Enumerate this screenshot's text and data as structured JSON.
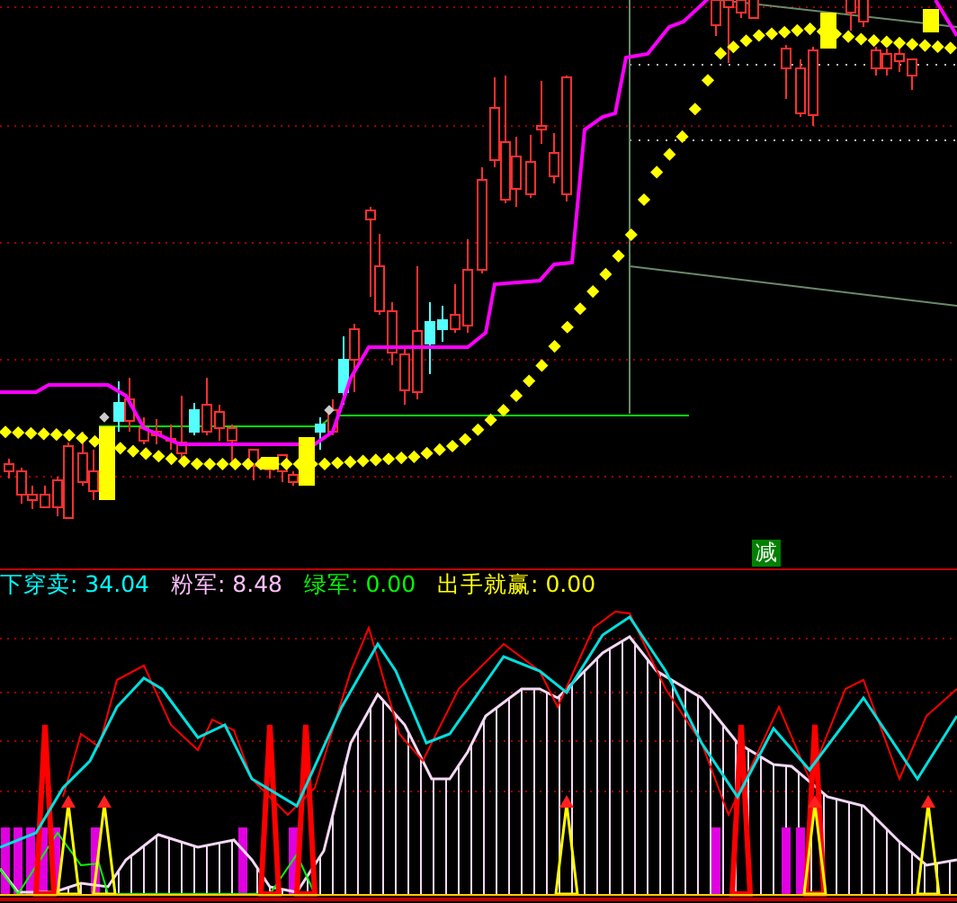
{
  "price_chart": {
    "signal_badge": "减"
  },
  "legend": [
    {
      "text": "下穿卖: 34.04",
      "color": "#00ffff"
    },
    {
      "text": "粉军: 8.48",
      "color": "#ffc0ff"
    },
    {
      "text": "绿军: 0.00",
      "color": "#00ff00"
    },
    {
      "text": "出手就赢: 0.00",
      "color": "#ffff00"
    }
  ]
}
